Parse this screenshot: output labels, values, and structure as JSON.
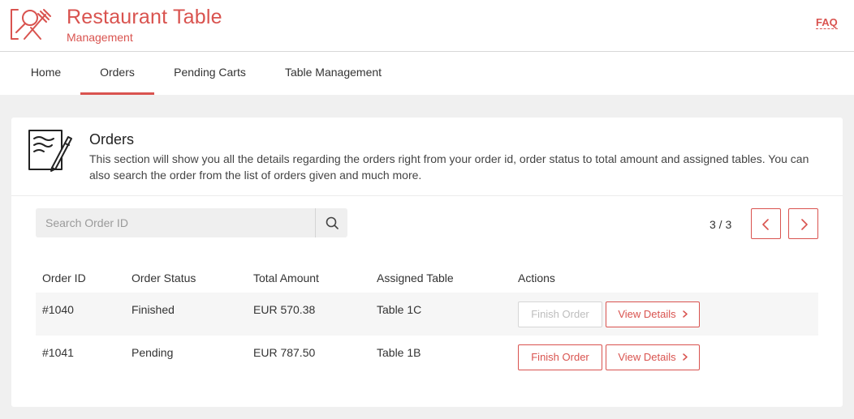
{
  "brand": {
    "title": "Restaurant Table",
    "subtitle": "Management"
  },
  "header": {
    "faq_label": "FAQ"
  },
  "nav": {
    "items": [
      {
        "label": "Home"
      },
      {
        "label": "Orders"
      },
      {
        "label": "Pending Carts"
      },
      {
        "label": "Table Management"
      }
    ],
    "active": "Orders"
  },
  "section": {
    "title": "Orders",
    "description": "This section will show you all the details regarding the orders right from your order id, order status to total amount and assigned tables. You can also search the order from the list of orders given and much more."
  },
  "search": {
    "placeholder": "Search Order ID",
    "value": ""
  },
  "pagination": {
    "label": "3 / 3"
  },
  "table": {
    "headers": {
      "order_id": "Order ID",
      "status": "Order Status",
      "amount": "Total Amount",
      "table": "Assigned Table",
      "actions": "Actions"
    },
    "rows": [
      {
        "order_id": "#1040",
        "status": "Finished",
        "amount": "EUR 570.38",
        "table": "Table 1C",
        "finish_label": "Finish Order",
        "finish_enabled": false,
        "details_label": "View Details"
      },
      {
        "order_id": "#1041",
        "status": "Pending",
        "amount": "EUR 787.50",
        "table": "Table 1B",
        "finish_label": "Finish Order",
        "finish_enabled": true,
        "details_label": "View Details"
      }
    ]
  },
  "colors": {
    "accent": "#d9534f",
    "background": "#f0f0f0",
    "row_shade": "#f6f6f6"
  }
}
